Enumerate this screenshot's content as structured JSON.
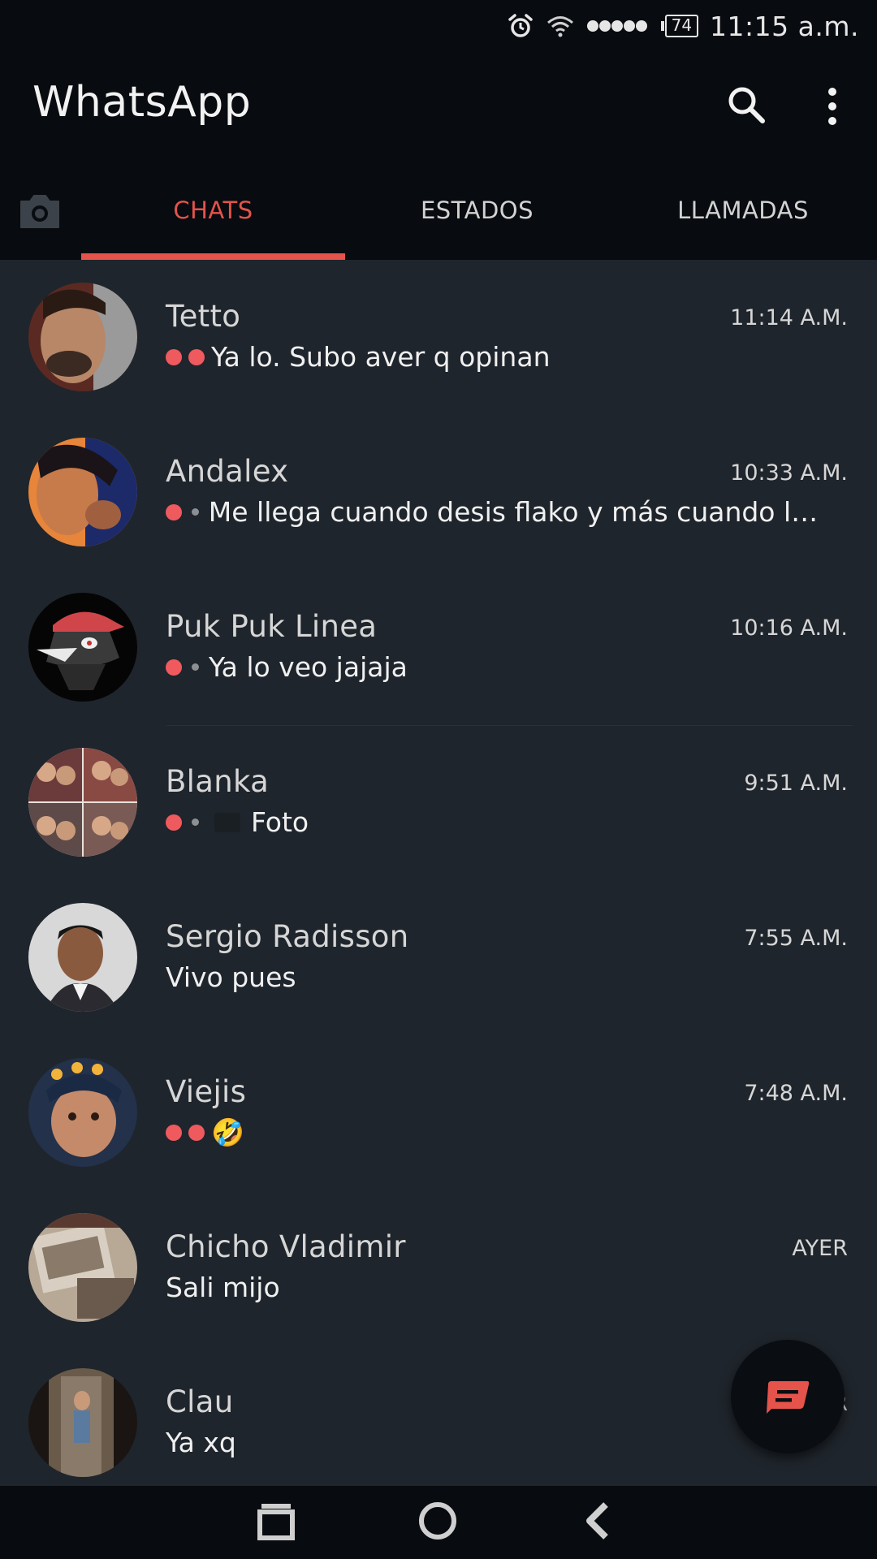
{
  "status_bar": {
    "time": "11:15 a.m.",
    "battery": "74",
    "icons": [
      "alarm-icon",
      "wifi-icon",
      "signal-dots-icon",
      "battery-icon"
    ]
  },
  "header": {
    "title": "WhatsApp",
    "icons": [
      "search-icon",
      "more-vert-icon"
    ]
  },
  "tabs": {
    "items": [
      {
        "label": "CHATS",
        "active": true
      },
      {
        "label": "ESTADOS",
        "active": false
      },
      {
        "label": "LLAMADAS",
        "active": false
      }
    ]
  },
  "chats": [
    {
      "name": "Tetto",
      "time": "11:14 A.M.",
      "ticks": "double",
      "preview": "Ya lo. Subo aver q opinan"
    },
    {
      "name": "Andalex",
      "time": "10:33 A.M.",
      "ticks": "single",
      "preview": "Me llega cuando desis flako y más cuando lo..."
    },
    {
      "name": "Puk Puk Linea",
      "time": "10:16 A.M.",
      "ticks": "single",
      "preview": "Ya lo veo jajaja"
    },
    {
      "name": "Blanka",
      "time": "9:51 A.M.",
      "ticks": "single",
      "preview": "Foto"
    },
    {
      "name": "Sergio Radisson",
      "time": "7:55 A.M.",
      "ticks": "none",
      "preview": "Vivo pues"
    },
    {
      "name": "Viejis",
      "time": "7:48 A.M.",
      "ticks": "double",
      "preview": "🤣"
    },
    {
      "name": "Chicho Vladimir",
      "time": "AYER",
      "ticks": "none",
      "preview": "Sali mijo"
    },
    {
      "name": "Clau",
      "time": "R",
      "ticks": "none",
      "preview": "Ya xq"
    }
  ],
  "colors": {
    "accent": "#e5534b",
    "background": "#1f252c",
    "bar": "#080b0f"
  },
  "fab": {
    "icon": "new-chat-icon"
  },
  "nav": {
    "icons": [
      "recents-icon",
      "home-icon",
      "back-icon"
    ]
  }
}
